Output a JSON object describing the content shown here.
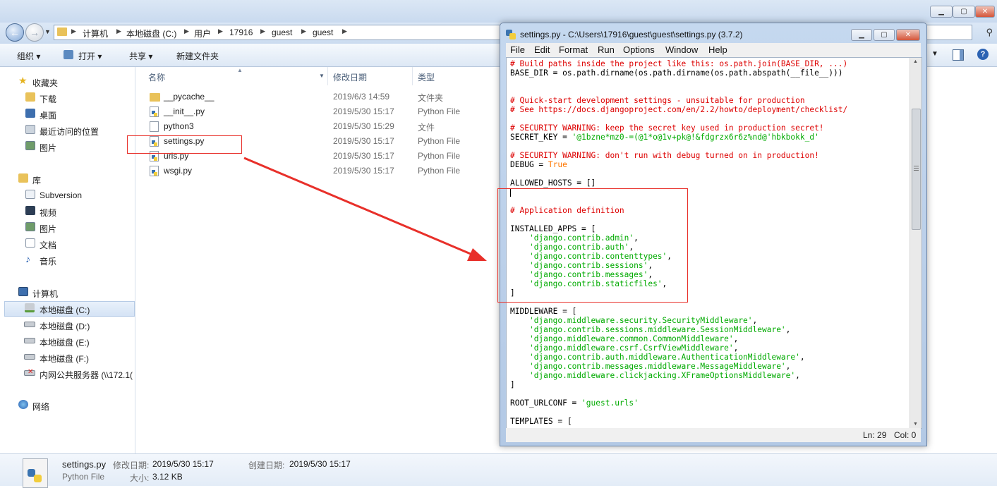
{
  "explorer": {
    "breadcrumbs": [
      "计算机",
      "本地磁盘 (C:)",
      "用户",
      "17916",
      "guest",
      "guest"
    ],
    "toolbar": {
      "organize": "组织 ▾",
      "open": "打开 ▾",
      "share": "共享 ▾",
      "new_folder": "新建文件夹"
    },
    "sidebar": {
      "favorites_label": "收藏夹",
      "favorites": [
        "下载",
        "桌面",
        "最近访问的位置",
        "图片"
      ],
      "libraries_label": "库",
      "libraries": [
        "Subversion",
        "视频",
        "图片",
        "文档",
        "音乐"
      ],
      "computer_label": "计算机",
      "drives": [
        "本地磁盘 (C:)",
        "本地磁盘 (D:)",
        "本地磁盘 (E:)",
        "本地磁盘 (F:)",
        "内网公共服务器 (\\\\172.1("
      ],
      "network_label": "网络"
    },
    "columns": {
      "name": "名称",
      "date": "修改日期",
      "type": "类型"
    },
    "files": [
      {
        "name": "__pycache__",
        "date": "2019/6/3 14:59",
        "type": "文件夹",
        "kind": "folder"
      },
      {
        "name": "__init__.py",
        "date": "2019/5/30 15:17",
        "type": "Python File",
        "kind": "python"
      },
      {
        "name": "python3",
        "date": "2019/5/30 15:29",
        "type": "文件",
        "kind": "file"
      },
      {
        "name": "settings.py",
        "date": "2019/5/30 15:17",
        "type": "Python File",
        "kind": "python"
      },
      {
        "name": "urls.py",
        "date": "2019/5/30 15:17",
        "type": "Python File",
        "kind": "python"
      },
      {
        "name": "wsgi.py",
        "date": "2019/5/30 15:17",
        "type": "Python File",
        "kind": "python"
      }
    ],
    "status": {
      "filename": "settings.py",
      "modified_label": "修改日期:",
      "modified": "2019/5/30 15:17",
      "created_label": "创建日期:",
      "created": "2019/5/30 15:17",
      "type": "Python File",
      "size_label": "大小:",
      "size": "3.12 KB"
    }
  },
  "idle": {
    "title": "settings.py - C:\\Users\\17916\\guest\\guest\\settings.py (3.7.2)",
    "menus": [
      "File",
      "Edit",
      "Format",
      "Run",
      "Options",
      "Window",
      "Help"
    ],
    "code_lines": [
      "# Build paths inside the project like this: os.path.join(BASE_DIR, ...)",
      "BASE_DIR = os.path.dirname(os.path.dirname(os.path.abspath(__file__)))",
      "",
      "",
      "# Quick-start development settings - unsuitable for production",
      "# See https://docs.djangoproject.com/en/2.2/howto/deployment/checklist/",
      "",
      "# SECURITY WARNING: keep the secret key used in production secret!",
      "SECRET_KEY = '@1bzne*mz0-=(@1*o@1v+pk@!&fdgrzx6r6z%nd@'hbkbokk_d'",
      "",
      "# SECURITY WARNING: don't run with debug turned on in production!",
      "DEBUG = True",
      "",
      "ALLOWED_HOSTS = []",
      "",
      "",
      "# Application definition",
      "",
      "INSTALLED_APPS = [",
      "    'django.contrib.admin',",
      "    'django.contrib.auth',",
      "    'django.contrib.contenttypes',",
      "    'django.contrib.sessions',",
      "    'django.contrib.messages',",
      "    'django.contrib.staticfiles',",
      "]",
      "",
      "MIDDLEWARE = [",
      "    'django.middleware.security.SecurityMiddleware',",
      "    'django.contrib.sessions.middleware.SessionMiddleware',",
      "    'django.middleware.common.CommonMiddleware',",
      "    'django.middleware.csrf.CsrfViewMiddleware',",
      "    'django.contrib.auth.middleware.AuthenticationMiddleware',",
      "    'django.contrib.messages.middleware.MessageMiddleware',",
      "    'django.middleware.clickjacking.XFrameOptionsMiddleware',",
      "]",
      "",
      "ROOT_URLCONF = 'guest.urls'",
      "",
      "TEMPLATES = ["
    ],
    "status": {
      "line": "Ln: 29",
      "col": "Col: 0"
    }
  },
  "colors": {
    "annotation": "#e8302a",
    "comment": "#dd0000",
    "string": "#00aa00",
    "keyword": "#ff7700"
  }
}
